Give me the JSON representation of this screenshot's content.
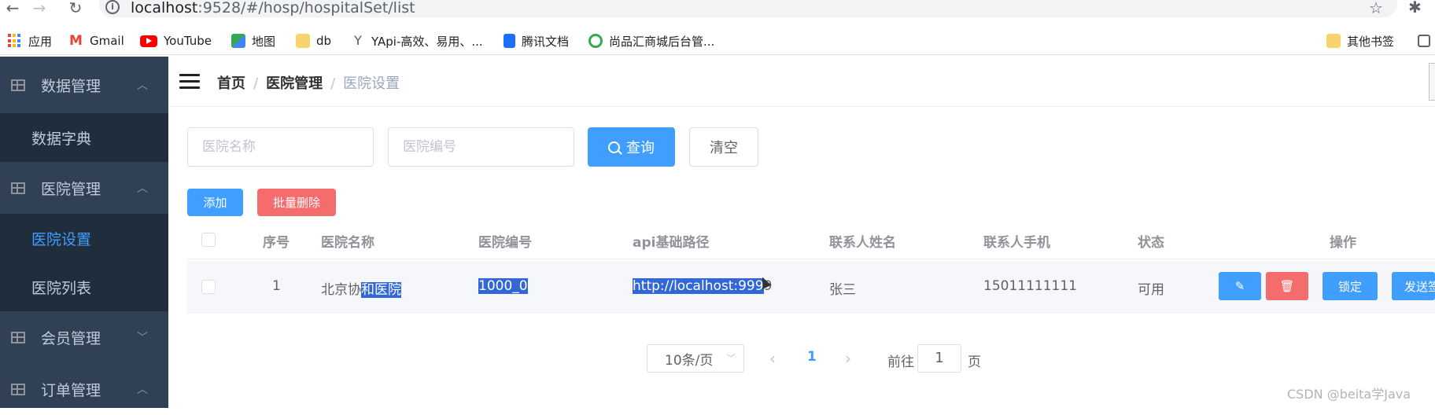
{
  "browser": {
    "url_host": "localhost",
    "url_rest": ":9528/#/hosp/hospitalSet/list",
    "bookmarks": [
      "应用",
      "Gmail",
      "YouTube",
      "地图",
      "db",
      "YApi-高效、易用、...",
      "腾讯文档",
      "尚品汇商城后台管...",
      "其他书签"
    ]
  },
  "sidebar": {
    "groups": [
      {
        "label": "数据管理",
        "expanded": true,
        "children": [
          "数据字典"
        ]
      },
      {
        "label": "医院管理",
        "expanded": true,
        "children": [
          "医院设置",
          "医院列表"
        ]
      },
      {
        "label": "会员管理",
        "expanded": false,
        "children": []
      },
      {
        "label": "订单管理",
        "expanded": true,
        "children": []
      }
    ],
    "active_item": "医院设置"
  },
  "breadcrumb": [
    "首页",
    "医院管理",
    "医院设置"
  ],
  "search": {
    "hosname_placeholder": "医院名称",
    "hoscode_placeholder": "医院编号",
    "query_label": "查询",
    "clear_label": "清空"
  },
  "actions": {
    "add_label": "添加",
    "batch_delete_label": "批量删除"
  },
  "table": {
    "headers": [
      "序号",
      "医院名称",
      "医院编号",
      "api基础路径",
      "联系人姓名",
      "联系人手机",
      "状态",
      "操作"
    ],
    "rows": [
      {
        "index": "1",
        "hosname_plain": "北京协",
        "hosname_sel": "和医院",
        "hoscode": "1000_0",
        "api_sel": "http://localhost:999",
        "api_plain": "9",
        "contact": "张三",
        "phone": "15011111111",
        "status": "可用",
        "lock_label": "锁定",
        "send_label": "发送签"
      }
    ]
  },
  "pagination": {
    "page_size": "10条/页",
    "current": "1",
    "goto_prefix": "前往",
    "goto_value": "1",
    "goto_suffix": "页"
  },
  "watermark": "CSDN @beita学Java",
  "colors": {
    "sidebar": "#304156",
    "submenu": "#1f2d3d",
    "primary": "#409eff",
    "danger": "#f56c6c"
  }
}
